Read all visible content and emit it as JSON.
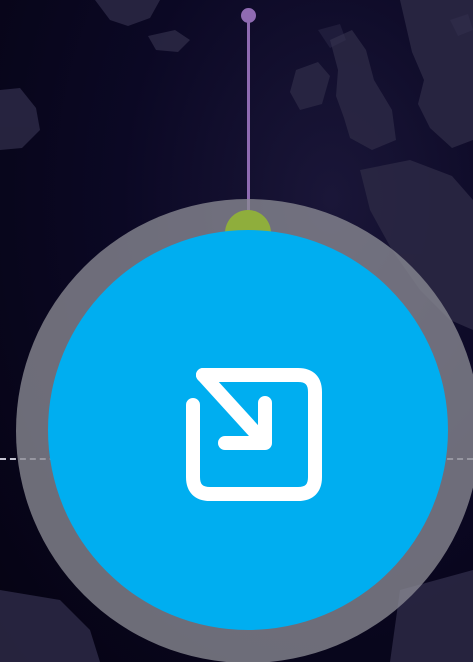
{
  "scene": {
    "background": "world-map-dark",
    "accent_color": "#00aef0",
    "ring_color": "#8a8a94",
    "status_color": "#8fae3c",
    "pin_color": "#8f6bb2"
  },
  "action_button": {
    "icon": "open-in-app-icon",
    "label": ""
  }
}
